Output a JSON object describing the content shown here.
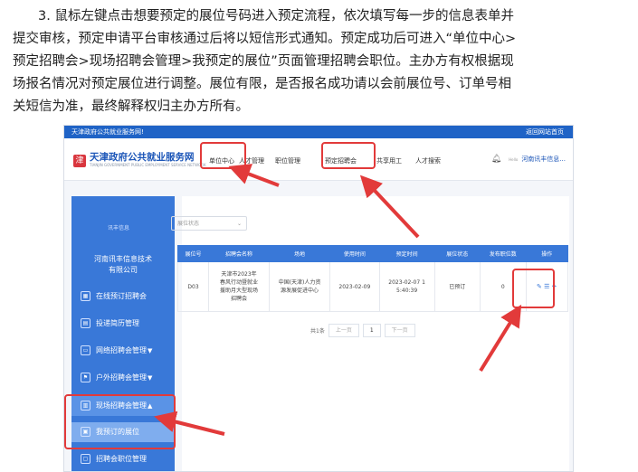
{
  "instruction": {
    "lines": [
      "3. 鼠标左键点击想要预定的展位号码进入预定流程，依次填写每一步的信息表单并",
      "提交审核，预定申请平台审核通过后将以短信形式通知。预定成功后可进入“单位中心>",
      "预定招聘会>现场招聘会管理>我预定的展位”页面管理招聘会职位。主办方有权根据现",
      "场报名情况对预定展位进行调整。展位有限，是否报名成功请以会前展位号、订单号相",
      "关短信为准，最终解释权归主办方所有。"
    ]
  },
  "topbar": {
    "left": "天津政府公共就业服务网!",
    "right": "返回网站首页"
  },
  "header": {
    "logo_mark": "津",
    "site_name": "天津政府公共就业服务网",
    "site_sub": "TIANJIN GOVERNMENT PUBLIC EMPLOYMENT SERVICE NETWORK",
    "nav": [
      "单位中心",
      "人才管理",
      "职位管理",
      "预定招聘会",
      "共享用工",
      "人才搜索"
    ],
    "user_name": "河南讯丰信息...",
    "mini_label": "Hello"
  },
  "sidebar": {
    "logo_text": "讯丰信息",
    "company": [
      "河南讯丰信息技术",
      "有限公司"
    ],
    "items": [
      {
        "label": "在线预订招聘会",
        "arrow": ""
      },
      {
        "label": "投递简历管理",
        "arrow": ""
      },
      {
        "label": "网络招聘会管理",
        "arrow": "▼"
      },
      {
        "label": "户外招聘会管理",
        "arrow": "▼"
      },
      {
        "label": "现场招聘会管理",
        "arrow": "▲"
      },
      {
        "label": "我预订的展位",
        "arrow": ""
      },
      {
        "label": "招聘会职位管理",
        "arrow": ""
      }
    ]
  },
  "main": {
    "filter_placeholder": "展位状态",
    "columns": [
      "展位号",
      "招聘会名称",
      "场地",
      "使用时间",
      "预定时间",
      "展位状态",
      "发布职位数",
      "操作"
    ],
    "row": {
      "booth": "D03",
      "fair_name": [
        "天津市2023年",
        "春风行动暨就业",
        "援助月大型现场",
        "招聘会"
      ],
      "venue": [
        "中国(天津)人力资",
        "源发展促进中心"
      ],
      "use_time": "2023-02-09",
      "book_time": [
        "2023-02-07 1",
        "5:40:39"
      ],
      "status": "已预订",
      "jobs": "0",
      "ops": "✎ ☰ ✈"
    },
    "pager": {
      "total": "共1条",
      "prev": "上一页",
      "page": "1",
      "next": "下一页"
    }
  },
  "colors": {
    "brand_blue": "#3978d8",
    "highlight_red": "#e23a3a"
  }
}
